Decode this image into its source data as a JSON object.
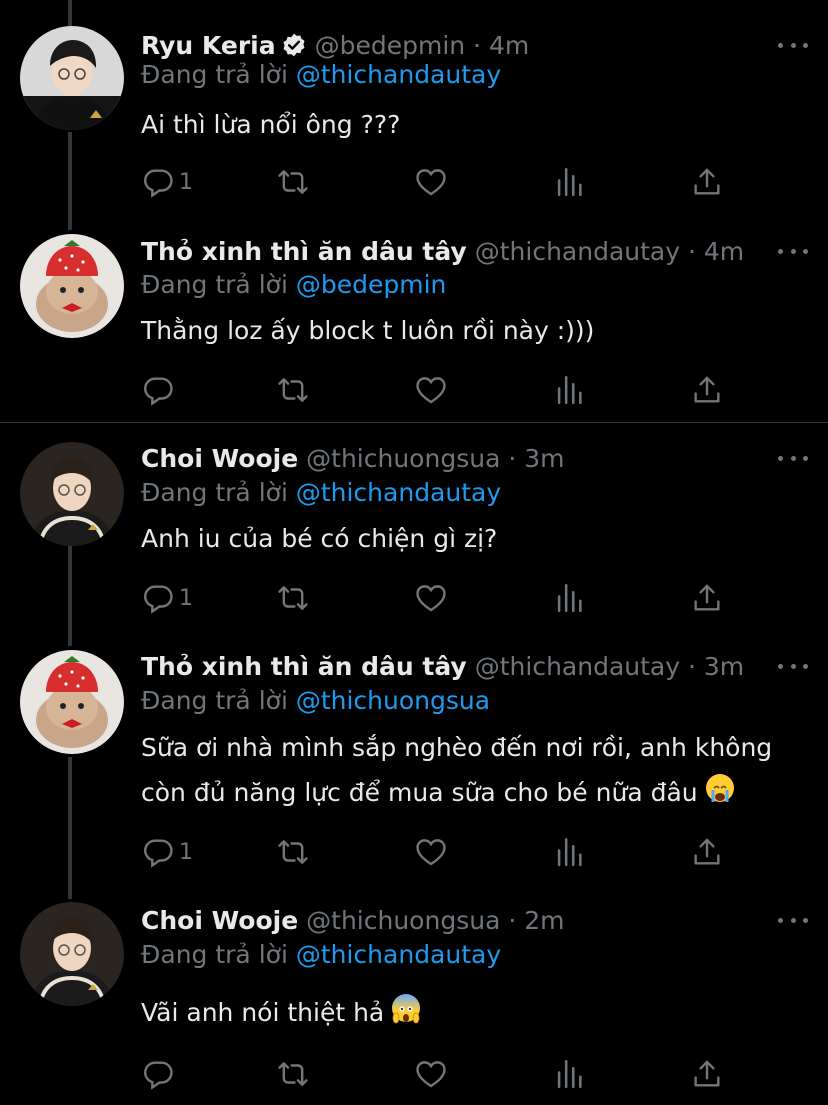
{
  "colors": {
    "background": "#000000",
    "text": "#e7e9ea",
    "muted": "#71767b",
    "accent": "#1d9bf0",
    "divider": "#2f3336"
  },
  "replying_prefix": "Đang trả lời",
  "tweets": [
    {
      "name": "Ryu Keria",
      "verified": true,
      "handle": "@bedepmin · 4m",
      "replying_to": "@thichandautay",
      "text": "Ai thì lừa nổi ông ???",
      "reply_count": "1",
      "avatar": "person-avatar-black-jacket",
      "icons": [
        "reply-icon",
        "retweet-icon",
        "like-icon",
        "stats-icon",
        "share-icon"
      ]
    },
    {
      "name": "Thỏ xinh thì ăn dâu tây",
      "verified": false,
      "handle": "@thichandautay · 4m",
      "replying_to": "@bedepmin",
      "text": "Thằng loz ấy block t luôn rồi này :)))",
      "reply_count": "",
      "avatar": "rabbit-strawberry-hat-avatar"
    },
    {
      "name": "Choi Wooje",
      "verified": false,
      "handle": "@thichuongsua · 3m",
      "replying_to": "@thichandautay",
      "text": "Anh iu của bé có chiện gì zị?",
      "reply_count": "1",
      "avatar": "person-avatar-varsity-jacket"
    },
    {
      "name": "Thỏ xinh thì ăn dâu tây",
      "verified": false,
      "handle": "@thichandautay · 3m",
      "replying_to": "@thichuongsua",
      "text_line1": "Sữa ơi nhà mình sắp nghèo đến nơi rồi, anh không",
      "text_line2": "còn đủ năng lực để mua sữa cho bé nữa đâu",
      "emoji": "loudly-crying-face",
      "reply_count": "1",
      "avatar": "rabbit-strawberry-hat-avatar"
    },
    {
      "name": "Choi Wooje",
      "verified": false,
      "handle": "@thichuongsua · 2m",
      "replying_to": "@thichandautay",
      "text": "Vãi anh nói thiệt hả",
      "emoji": "face-screaming-in-fear",
      "reply_count": "",
      "avatar": "person-avatar-varsity-jacket"
    }
  ]
}
